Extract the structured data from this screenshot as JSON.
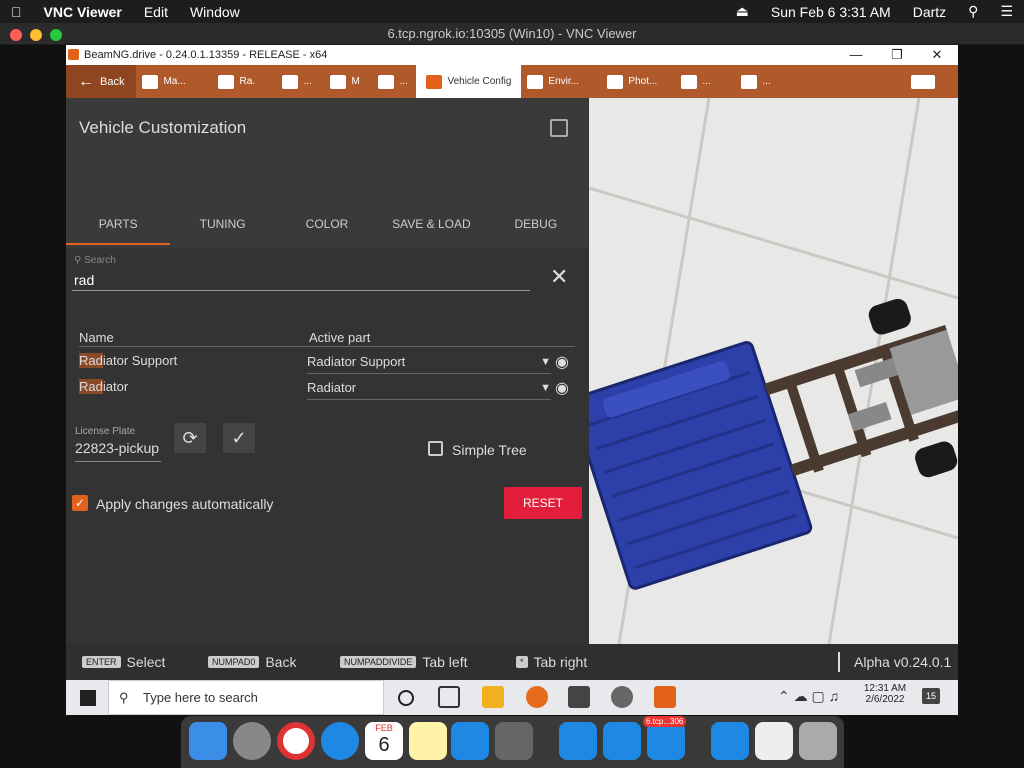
{
  "menubar": {
    "app": "VNC Viewer",
    "items": [
      "Edit",
      "Window"
    ],
    "clock": "Sun Feb 6  3:31 AM",
    "user": "Dartz"
  },
  "vnc": {
    "title": "6.tcp.ngrok.io:10305 (Win10) - VNC Viewer"
  },
  "app": {
    "window_title": "BeamNG.drive - 0.24.0.1.13359 - RELEASE - x64",
    "tabs": {
      "back": "Back",
      "t1": "Ma...",
      "t2": "Ra.",
      "t3": "...",
      "t4": "M",
      "t5": "...",
      "active": "Vehicle Config",
      "t7": "Envir...",
      "t8": "Phot...",
      "t9": "...",
      "t10": "..."
    },
    "panel": {
      "title": "Vehicle Customization",
      "subtabs": [
        "PARTS",
        "TUNING",
        "COLOR",
        "SAVE & LOAD",
        "DEBUG"
      ],
      "search_label": "Search",
      "search_value": "rad",
      "col_name": "Name",
      "col_active": "Active part",
      "rows": [
        {
          "hl": "Rad",
          "rest": "iator Support",
          "active": "Radiator Support"
        },
        {
          "hl": "Rad",
          "rest": "iator",
          "active": "Radiator"
        }
      ],
      "license_label": "License Plate",
      "license_value": "22823-pickup",
      "simple_tree": "Simple Tree",
      "apply_auto": "Apply changes automatically",
      "reset": "RESET"
    },
    "hints": [
      {
        "key": "ENTER",
        "label": "Select"
      },
      {
        "key": "NUMPAD0",
        "label": "Back"
      },
      {
        "key": "NUMPADDIVIDE",
        "label": "Tab left"
      },
      {
        "key": "*",
        "label": "Tab right"
      }
    ],
    "version": "Alpha v0.24.0.1",
    "taskbar": {
      "search": "Type here to search",
      "time": "12:31 AM",
      "date": "2/6/2022",
      "notif": "15"
    }
  },
  "dock": {
    "calendar_month": "FEB",
    "calendar_day": "6",
    "badge": "6.tcp...306"
  },
  "colors": {
    "accent": "#e2621b",
    "reset": "#e31e3a",
    "tabbar": "#b05a2c"
  }
}
